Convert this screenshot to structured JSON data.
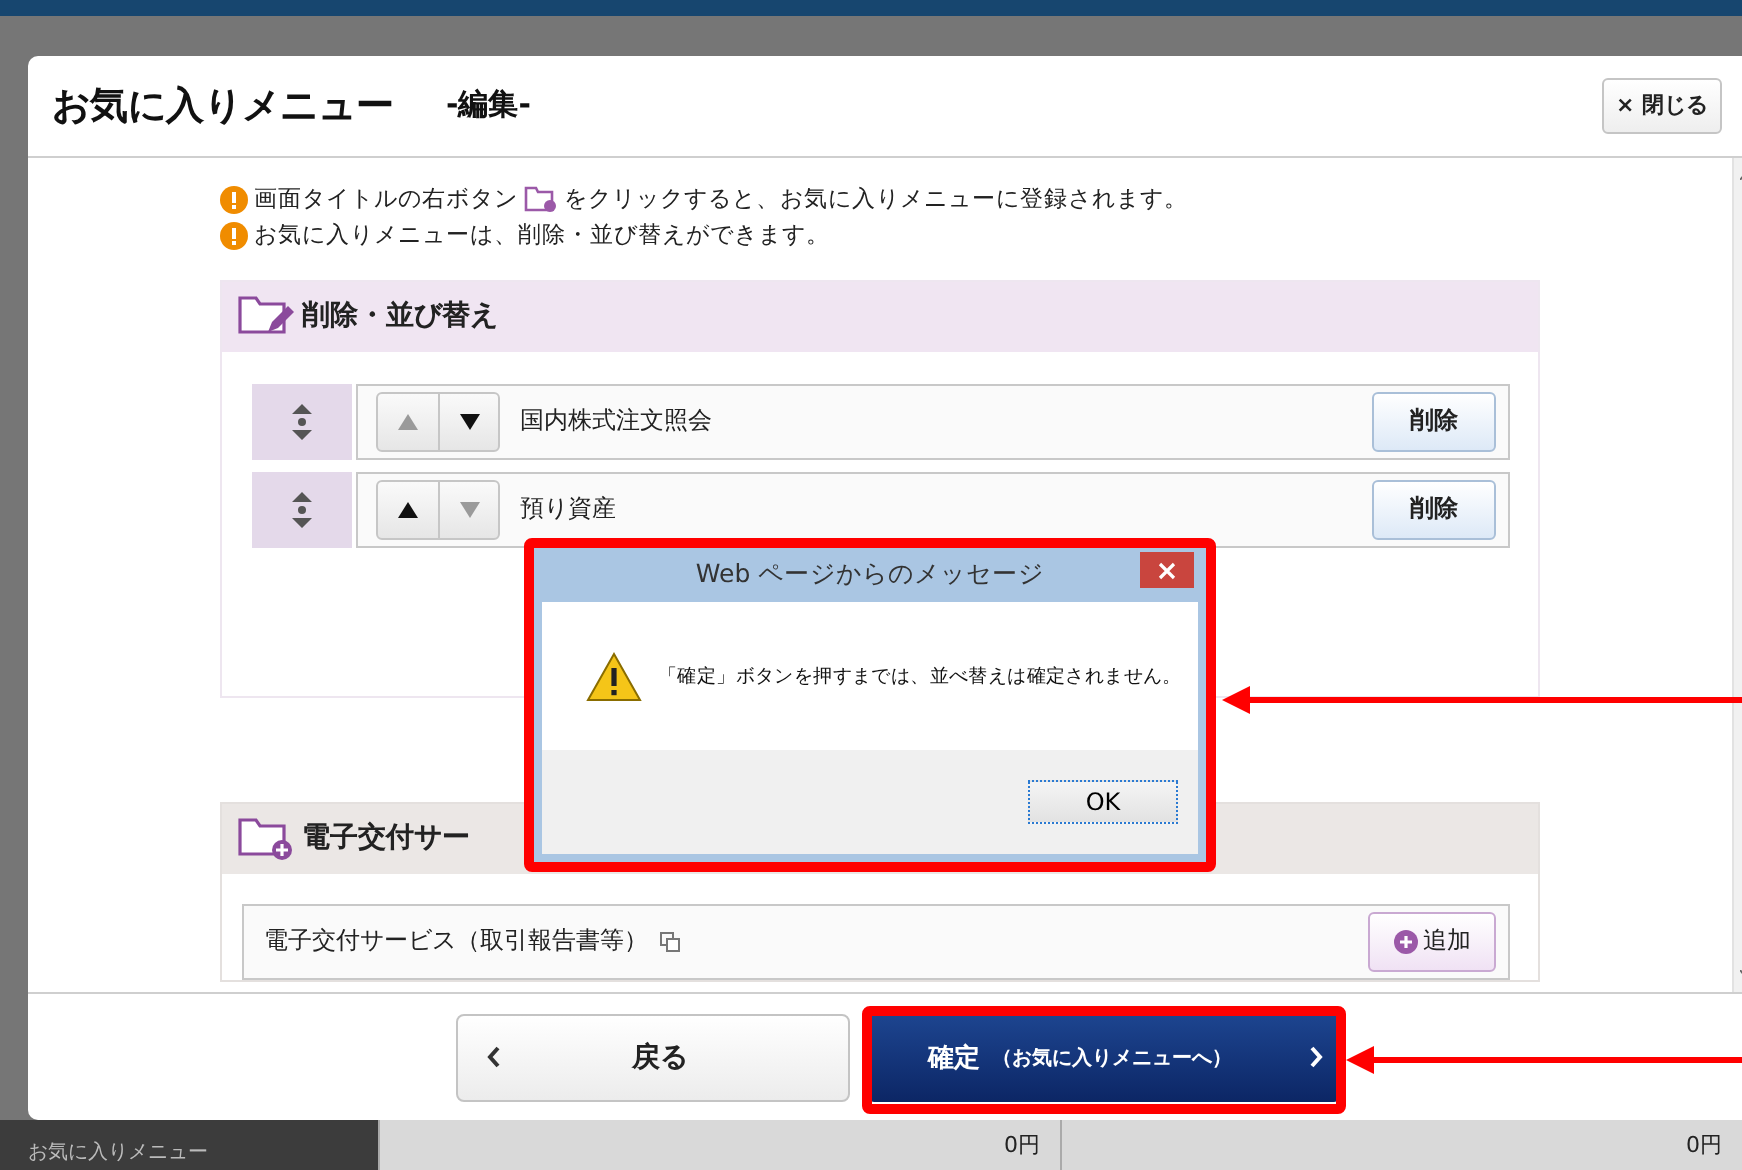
{
  "background": {
    "bottom_label": "お気に入りメニュー",
    "amounts": [
      "0円",
      "0円"
    ]
  },
  "modal": {
    "title": "お気に入りメニュー",
    "subtitle": "-編集-",
    "close_button": "× 閉じる",
    "notes": [
      {
        "before": "画面タイトルの右ボタン",
        "after": "をクリックすると、お気に入りメニューに登録されます。"
      },
      {
        "before": "お気に入りメニューは、削除・並び替えができます。"
      }
    ],
    "sections": [
      {
        "kind": "sort",
        "title": "削除・並び替え",
        "items": [
          {
            "label": "国内株式注文照会",
            "up_disabled": true,
            "down_disabled": false,
            "button": "削除"
          },
          {
            "label": "預り資産",
            "up_disabled": false,
            "down_disabled": true,
            "button": "削除"
          }
        ]
      },
      {
        "kind": "add",
        "title": "電子交付サー",
        "items": [
          {
            "label": "電子交付サービス（取引報告書等）",
            "button": "追加"
          }
        ]
      }
    ],
    "back_button": "戻る",
    "confirm_button": {
      "label": "確定",
      "sub": "（お気に入りメニューへ）"
    }
  },
  "dialog": {
    "title": "Web ページからのメッセージ",
    "message": "「確定」ボタンを押すまでは、並べ替えは確定されません。",
    "ok_button": "OK"
  }
}
